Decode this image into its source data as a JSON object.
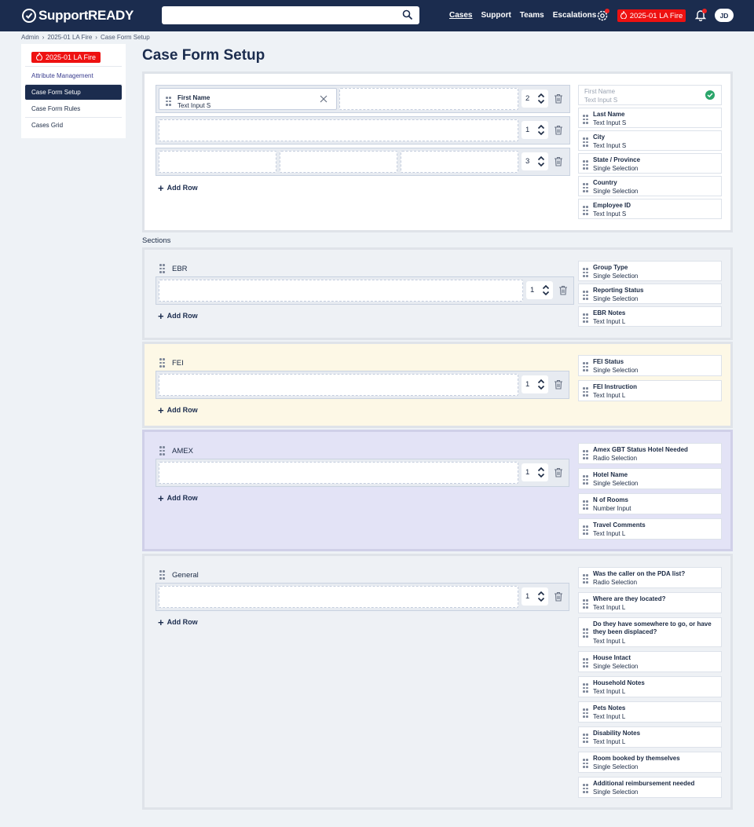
{
  "app": {
    "name": "SupportREADY"
  },
  "topnav": {
    "items": [
      "Cases",
      "Support",
      "Teams",
      "Escalations"
    ],
    "escalations_badge": "1",
    "event": "2025-01 LA Fire",
    "notif_badge": "1",
    "user_initials": "JD"
  },
  "breadcrumb": [
    "Admin",
    "2025-01 LA Fire",
    "Case Form Setup"
  ],
  "sidebar": {
    "event": "2025-01 LA Fire",
    "items": [
      "Attribute Management",
      "Case Form Setup",
      "Case Form Rules",
      "Cases Grid"
    ]
  },
  "page": {
    "title": "Case Form Setup",
    "sections_label": "Sections",
    "add_row": "Add Row"
  },
  "header_block": {
    "rows": [
      {
        "count": "2",
        "field_label": "First Name",
        "field_sub": "Text Input S"
      },
      {
        "count": "1"
      },
      {
        "count": "3"
      }
    ],
    "fields": [
      {
        "label": "First Name",
        "sub": "Text Input S",
        "used": true
      },
      {
        "label": "Last Name",
        "sub": "Text Input S"
      },
      {
        "label": "City",
        "sub": "Text Input S"
      },
      {
        "label": "State / Province",
        "sub": "Single Selection"
      },
      {
        "label": "Country",
        "sub": "Single Selection"
      },
      {
        "label": "Employee ID",
        "sub": "Text Input S"
      }
    ]
  },
  "sections": [
    {
      "title": "EBR",
      "count": "1",
      "fields": [
        {
          "label": "Group Type",
          "sub": "Single Selection"
        },
        {
          "label": "Reporting Status",
          "sub": "Single Selection"
        },
        {
          "label": "EBR Notes",
          "sub": "Text Input L"
        }
      ]
    },
    {
      "title": "FEI",
      "count": "1",
      "fields": [
        {
          "label": "FEI Status",
          "sub": "Single Selection"
        },
        {
          "label": "FEI Instruction",
          "sub": "Text Input L"
        }
      ]
    },
    {
      "title": "AMEX",
      "count": "1",
      "fields": [
        {
          "label": "Amex GBT Status Hotel Needed",
          "sub": "Radio Selection"
        },
        {
          "label": "Hotel Name",
          "sub": "Single Selection"
        },
        {
          "label": "N of Rooms",
          "sub": "Number Input"
        },
        {
          "label": "Travel Comments",
          "sub": "Text Input L"
        }
      ]
    },
    {
      "title": "General",
      "count": "1",
      "fields": [
        {
          "label": "Was the caller on the PDA list?",
          "sub": "Radio Selection"
        },
        {
          "label": "Where are they located?",
          "sub": "Text Input L"
        },
        {
          "label": "Do they have somewhere to go, or have they been displaced?",
          "sub": "Text Input L"
        },
        {
          "label": "House Intact",
          "sub": "Single Selection"
        },
        {
          "label": "Household Notes",
          "sub": "Text Input L"
        },
        {
          "label": "Pets Notes",
          "sub": "Text Input L"
        },
        {
          "label": "Disability Notes",
          "sub": "Text Input L"
        },
        {
          "label": "Room booked by themselves",
          "sub": "Single Selection"
        },
        {
          "label": "Additional reimbursement needed",
          "sub": "Single Selection"
        }
      ]
    }
  ],
  "colors": {
    "navy": "#1b2c4e",
    "accent_red": "#e11111",
    "ebr_bg": "#eef1f5",
    "fei_bg": "#fdf8e6",
    "amex_bg": "#e3e3f6"
  }
}
